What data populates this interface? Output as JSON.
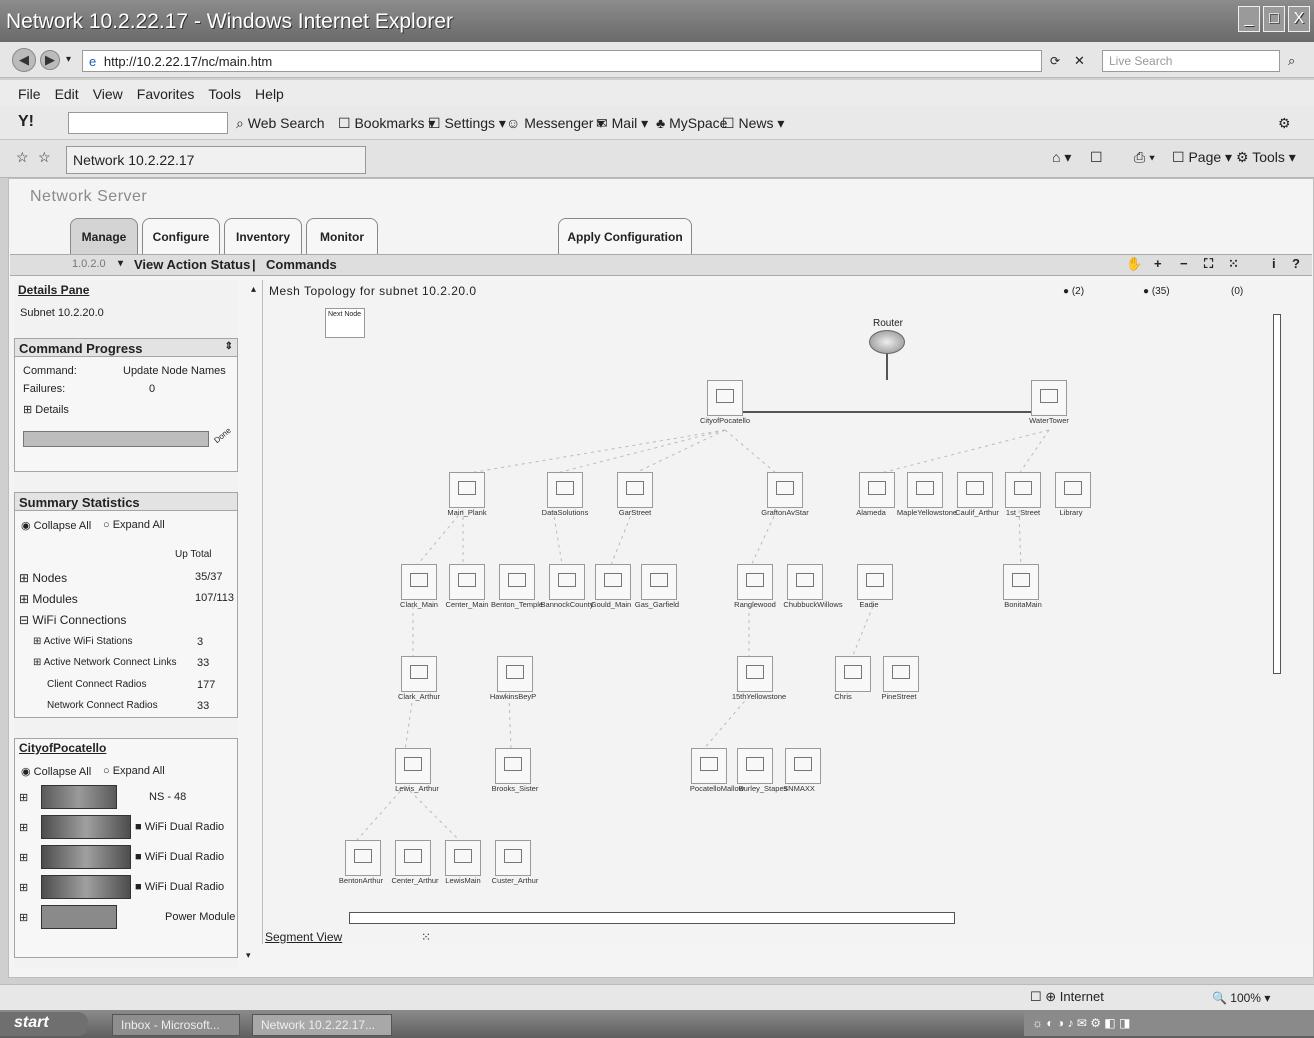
{
  "window": {
    "title": "Network 10.2.22.17 - Windows Internet Explorer",
    "min": "_",
    "max": "□",
    "close": "X"
  },
  "address": {
    "url": "http://10.2.22.17/nc/main.htm",
    "search_placeholder": "Live Search"
  },
  "menu": [
    "File",
    "Edit",
    "View",
    "Favorites",
    "Tools",
    "Help"
  ],
  "yahoo": {
    "web_search": "Web Search",
    "bookmarks": "Bookmarks",
    "settings": "Settings",
    "messenger": "Messenger",
    "mail": "Mail",
    "myspace": "MySpace",
    "news": "News"
  },
  "tab": {
    "title": "Network 10.2.22.17",
    "page": "Page",
    "tools": "Tools"
  },
  "app": {
    "server_title": "Network Server",
    "tabs": [
      "Manage",
      "Configure",
      "Inventory",
      "Monitor"
    ],
    "apply": "Apply Configuration",
    "cmdbar": {
      "version": "1.0.2.0",
      "view_action": "View Action Status",
      "separator": "|",
      "commands": "Commands"
    }
  },
  "details": {
    "title": "Details Pane",
    "subnet": "Subnet 10.2.20.0"
  },
  "command_progress": {
    "title": "Command Progress",
    "command_label": "Command:",
    "command_value": "Update Node Names",
    "failures_label": "Failures:",
    "failures_value": "0",
    "details": "Details",
    "done": "Done"
  },
  "summary": {
    "title": "Summary Statistics",
    "collapse": "Collapse All",
    "expand": "Expand All",
    "col_header": "Up Total",
    "rows": [
      {
        "label": "Nodes",
        "value": "35/37"
      },
      {
        "label": "Modules",
        "value": "107/113"
      },
      {
        "label": "WiFi Connections",
        "value": ""
      },
      {
        "label": "Active WiFi Stations",
        "value": "3"
      },
      {
        "label": "Active Network Connect Links",
        "value": "33"
      },
      {
        "label": "Client Connect Radios",
        "value": "177"
      },
      {
        "label": "Network Connect Radios",
        "value": "33"
      }
    ]
  },
  "city": {
    "title": "CityofPocatello",
    "collapse": "Collapse All",
    "expand": "Expand All",
    "modules": [
      "NS - 48",
      "WiFi Dual Radio",
      "WiFi Dual Radio",
      "WiFi Dual Radio",
      "Power Module"
    ]
  },
  "topology": {
    "title": "Mesh Topology for subnet 10.2.20.0",
    "counts": [
      "(2)",
      "(35)",
      "(0)"
    ],
    "next_node": "Next Node",
    "router": "Router",
    "segment_view": "Segment View",
    "nodes": {
      "n1": "CityofPocatello",
      "n2": "WaterTower",
      "n3": "Main_Plank",
      "n4": "DataSolutions",
      "n5": "GarStreet",
      "n6": "GraftonAvStar",
      "n7": "Alameda",
      "n8": "MapleYellowstone",
      "n9": "Caulif_Arthur",
      "n10": "1st_Street",
      "n11": "Library",
      "n12": "Clark_Main",
      "n13": "Center_Main",
      "n14": "Benton_Temple",
      "n15": "BannockCounty",
      "n16": "Gould_Main",
      "n17": "Gas_Garfield",
      "n18": "Ranglewood",
      "n19": "ChubbuckWillows",
      "n20": "Eadie",
      "n21": "BonitaMain",
      "n22": "Clark_Arthur",
      "n23": "HawkinsBeyP",
      "n24": "15thYellowstone",
      "n25": "Chris",
      "n26": "PineStreet",
      "n27": "Lewis_Arthur",
      "n28": "Brooks_Sister",
      "n29": "PocatelloMallow",
      "n30": "Burley_Stapes",
      "n31": "SNMAXX",
      "n32": "BentonArthur",
      "n33": "Center_Arthur",
      "n34": "LewisMain",
      "n35": "Custer_Arthur"
    }
  },
  "status": {
    "zone": "Internet",
    "zoom": "100%"
  },
  "taskbar": {
    "start": "start",
    "t1": "Inbox - Microsoft...",
    "t2": "Network 10.2.22.17..."
  }
}
